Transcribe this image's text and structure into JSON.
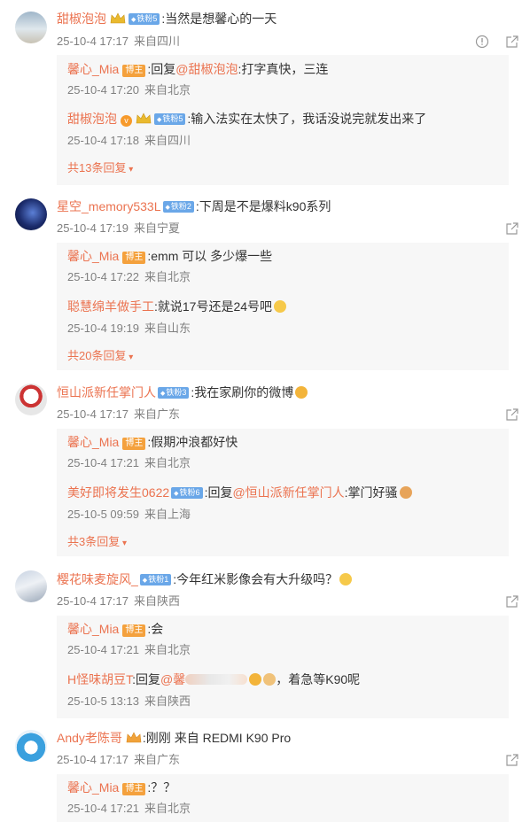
{
  "threads": [
    {
      "user": "甜椒泡泡",
      "fan_badge": "铁粉5",
      "text": ":当然是想馨心的一天",
      "date": "25-10-4 17:17",
      "loc": "来自四川",
      "replies": [
        {
          "user": "馨心_Mia",
          "badge": "博主",
          "pre": ":回复",
          "at": "@甜椒泡泡",
          "text": ":打字真快，三连",
          "date": "25-10-4 17:20",
          "loc": "来自北京"
        },
        {
          "user": "甜椒泡泡",
          "fan_badge": "铁粉5",
          "text": ":输入法实在太快了，我话没说完就发出来了",
          "date": "25-10-4 17:18",
          "loc": "来自四川"
        }
      ],
      "more": "共13条回复"
    },
    {
      "user": "星空_memory533L",
      "fan_badge": "铁粉2",
      "text": ":下周是不是爆料k90系列",
      "date": "25-10-4 17:19",
      "loc": "来自宁夏",
      "replies": [
        {
          "user": "馨心_Mia",
          "badge": "博主",
          "text": ":emm 可以 多少爆一些",
          "date": "25-10-4 17:22",
          "loc": "来自北京"
        },
        {
          "user": "聪慧绵羊做手工",
          "text": ":就说17号还是24号吧",
          "date": "25-10-4 19:19",
          "loc": "来自山东"
        }
      ],
      "more": "共20条回复"
    },
    {
      "user": "恒山派新任掌门人",
      "fan_badge": "铁粉3",
      "text": ":我在家刷你的微博",
      "date": "25-10-4 17:17",
      "loc": "来自广东",
      "replies": [
        {
          "user": "馨心_Mia",
          "badge": "博主",
          "text": ":假期冲浪都好快",
          "date": "25-10-4 17:21",
          "loc": "来自北京"
        },
        {
          "user": "美好即将发生0622",
          "fan_badge": "铁粉6",
          "pre": ":回复",
          "at": "@恒山派新任掌门人",
          "text": ":掌门好骚",
          "date": "25-10-5 09:59",
          "loc": "来自上海"
        }
      ],
      "more": "共3条回复"
    },
    {
      "user": "樱花味麦旋风_",
      "fan_badge": "铁粉1",
      "text": ":今年红米影像会有大升级吗？",
      "date": "25-10-4 17:17",
      "loc": "来自陕西",
      "replies": [
        {
          "user": "馨心_Mia",
          "badge": "博主",
          "text": ":会",
          "date": "25-10-4 17:21",
          "loc": "来自北京"
        },
        {
          "user": "H怪味胡豆T",
          "pre": ":回复",
          "at": "@馨",
          "text": "，着急等K90呢",
          "date": "25-10-5 13:13",
          "loc": "来自陕西"
        }
      ]
    },
    {
      "user": "Andy老陈哥",
      "text": ":刚刚 来自 REDMI K90  Pro",
      "date": "25-10-4 17:17",
      "loc": "来自广东",
      "replies": [
        {
          "user": "馨心_Mia",
          "badge": "博主",
          "text": ":？？",
          "date": "25-10-4 17:21",
          "loc": "来自北京"
        }
      ]
    }
  ]
}
